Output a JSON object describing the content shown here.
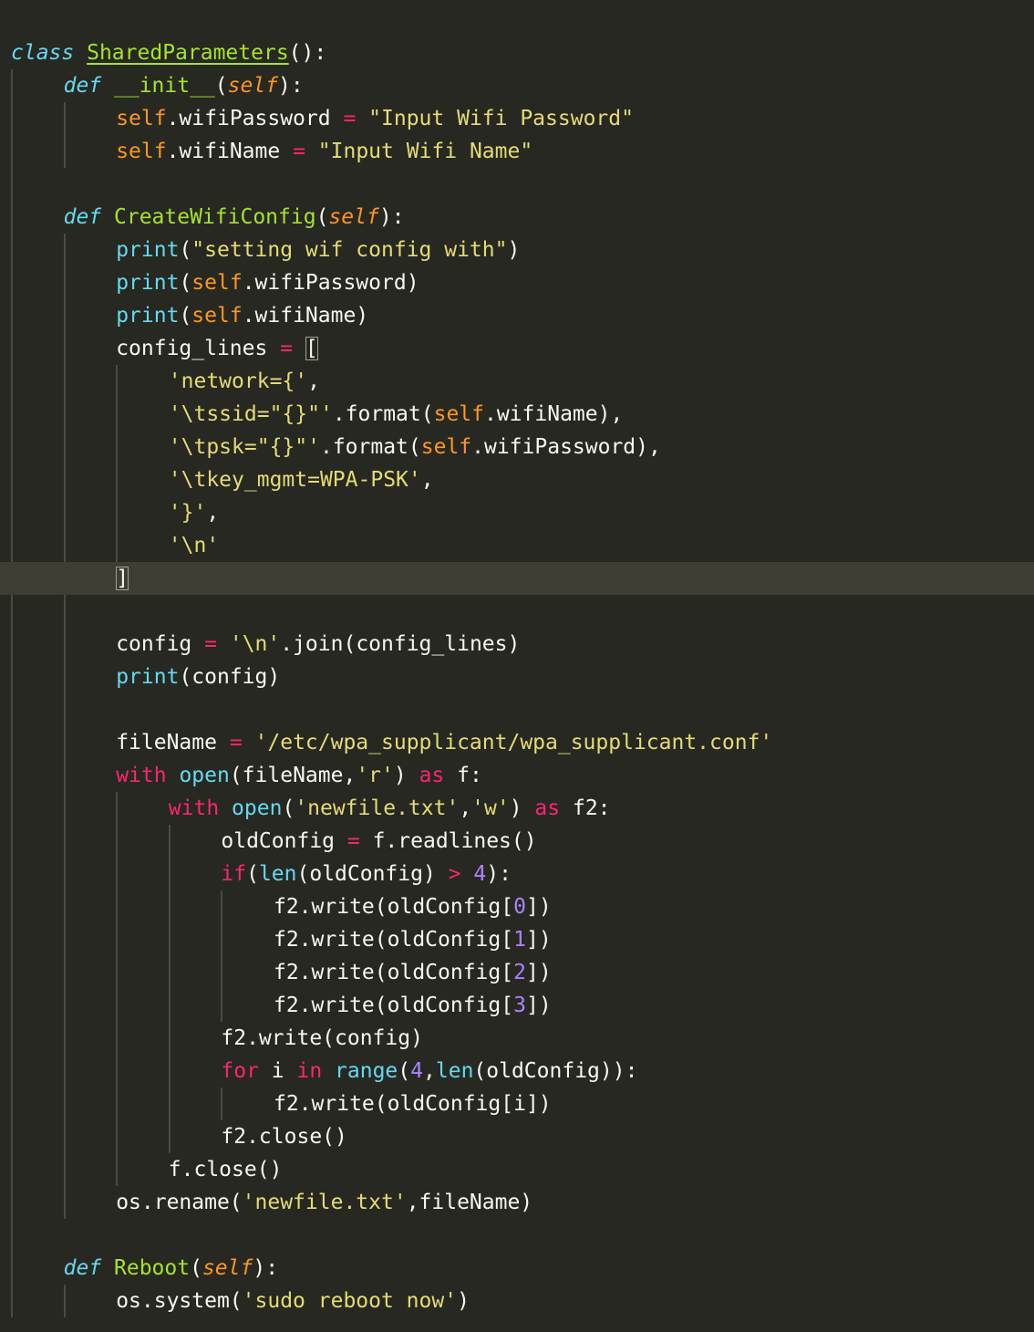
{
  "editor": {
    "language": "python",
    "highlighted_line": 16,
    "colors": {
      "background": "#272822",
      "highlight": "#3e3d32",
      "keyword": "#f92672",
      "storage": "#66d9ef",
      "function": "#a6e22e",
      "string": "#e6db74",
      "number": "#ae81ff",
      "self": "#fd971f",
      "text": "#f8f8f2"
    },
    "lines": [
      {
        "indent": 0,
        "tokens": [
          {
            "t": "class",
            "c": "d"
          },
          {
            "t": " "
          },
          {
            "t": "SharedParameters",
            "c": "cn"
          },
          {
            "t": "():"
          }
        ]
      },
      {
        "indent": 1,
        "tokens": [
          {
            "t": "def",
            "c": "d"
          },
          {
            "t": " "
          },
          {
            "t": "__init__",
            "c": "fn"
          },
          {
            "t": "("
          },
          {
            "t": "self",
            "c": "p"
          },
          {
            "t": "):"
          }
        ]
      },
      {
        "indent": 2,
        "tokens": [
          {
            "t": "self",
            "c": "sf"
          },
          {
            "t": ".wifiPassword "
          },
          {
            "t": "=",
            "c": "k"
          },
          {
            "t": " "
          },
          {
            "t": "\"Input Wifi Password\"",
            "c": "s"
          }
        ]
      },
      {
        "indent": 2,
        "tokens": [
          {
            "t": "self",
            "c": "sf"
          },
          {
            "t": ".wifiName "
          },
          {
            "t": "=",
            "c": "k"
          },
          {
            "t": " "
          },
          {
            "t": "\"Input Wifi Name\"",
            "c": "s"
          }
        ]
      },
      {
        "indent": 0,
        "tokens": []
      },
      {
        "indent": 1,
        "tokens": [
          {
            "t": "def",
            "c": "d"
          },
          {
            "t": " "
          },
          {
            "t": "CreateWifiConfig",
            "c": "fn"
          },
          {
            "t": "("
          },
          {
            "t": "self",
            "c": "p"
          },
          {
            "t": "):"
          }
        ]
      },
      {
        "indent": 2,
        "tokens": [
          {
            "t": "print",
            "c": "b"
          },
          {
            "t": "("
          },
          {
            "t": "\"setting wif config with\"",
            "c": "s"
          },
          {
            "t": ")"
          }
        ]
      },
      {
        "indent": 2,
        "tokens": [
          {
            "t": "print",
            "c": "b"
          },
          {
            "t": "("
          },
          {
            "t": "self",
            "c": "sf"
          },
          {
            "t": ".wifiPassword)"
          }
        ]
      },
      {
        "indent": 2,
        "tokens": [
          {
            "t": "print",
            "c": "b"
          },
          {
            "t": "("
          },
          {
            "t": "self",
            "c": "sf"
          },
          {
            "t": ".wifiName)"
          }
        ]
      },
      {
        "indent": 2,
        "tokens": [
          {
            "t": "config_lines "
          },
          {
            "t": "=",
            "c": "k"
          },
          {
            "t": " "
          },
          {
            "t": "[",
            "c": "bm"
          }
        ]
      },
      {
        "indent": 3,
        "tokens": [
          {
            "t": "'network={'",
            "c": "s"
          },
          {
            "t": ","
          }
        ]
      },
      {
        "indent": 3,
        "tokens": [
          {
            "t": "'\\tssid=\"{}\"'",
            "c": "s"
          },
          {
            "t": ".format("
          },
          {
            "t": "self",
            "c": "sf"
          },
          {
            "t": ".wifiName),"
          }
        ]
      },
      {
        "indent": 3,
        "tokens": [
          {
            "t": "'\\tpsk=\"{}\"'",
            "c": "s"
          },
          {
            "t": ".format("
          },
          {
            "t": "self",
            "c": "sf"
          },
          {
            "t": ".wifiPassword),"
          }
        ]
      },
      {
        "indent": 3,
        "tokens": [
          {
            "t": "'\\tkey_mgmt=WPA-PSK'",
            "c": "s"
          },
          {
            "t": ","
          }
        ]
      },
      {
        "indent": 3,
        "tokens": [
          {
            "t": "'}'",
            "c": "s"
          },
          {
            "t": ","
          }
        ]
      },
      {
        "indent": 3,
        "tokens": [
          {
            "t": "'\\n'",
            "c": "s"
          }
        ]
      },
      {
        "indent": 2,
        "tokens": [
          {
            "t": "]",
            "c": "bm"
          }
        ]
      },
      {
        "indent": 0,
        "tokens": []
      },
      {
        "indent": 2,
        "tokens": [
          {
            "t": "config "
          },
          {
            "t": "=",
            "c": "k"
          },
          {
            "t": " "
          },
          {
            "t": "'\\n'",
            "c": "s"
          },
          {
            "t": ".join(config_lines)"
          }
        ]
      },
      {
        "indent": 2,
        "tokens": [
          {
            "t": "print",
            "c": "b"
          },
          {
            "t": "(config)"
          }
        ]
      },
      {
        "indent": 0,
        "tokens": []
      },
      {
        "indent": 2,
        "tokens": [
          {
            "t": "fileName "
          },
          {
            "t": "=",
            "c": "k"
          },
          {
            "t": " "
          },
          {
            "t": "'/etc/wpa_supplicant/wpa_supplicant.conf'",
            "c": "s"
          }
        ]
      },
      {
        "indent": 2,
        "tokens": [
          {
            "t": "with",
            "c": "k"
          },
          {
            "t": " "
          },
          {
            "t": "open",
            "c": "b"
          },
          {
            "t": "(fileName,"
          },
          {
            "t": "'r'",
            "c": "s"
          },
          {
            "t": ") "
          },
          {
            "t": "as",
            "c": "k"
          },
          {
            "t": " f:"
          }
        ]
      },
      {
        "indent": 3,
        "tokens": [
          {
            "t": "with",
            "c": "k"
          },
          {
            "t": " "
          },
          {
            "t": "open",
            "c": "b"
          },
          {
            "t": "("
          },
          {
            "t": "'newfile.txt'",
            "c": "s"
          },
          {
            "t": ","
          },
          {
            "t": "'w'",
            "c": "s"
          },
          {
            "t": ") "
          },
          {
            "t": "as",
            "c": "k"
          },
          {
            "t": " f2:"
          }
        ]
      },
      {
        "indent": 4,
        "tokens": [
          {
            "t": "oldConfig "
          },
          {
            "t": "=",
            "c": "k"
          },
          {
            "t": " f.readlines()"
          }
        ]
      },
      {
        "indent": 4,
        "tokens": [
          {
            "t": "if",
            "c": "k"
          },
          {
            "t": "("
          },
          {
            "t": "len",
            "c": "b"
          },
          {
            "t": "(oldConfig) "
          },
          {
            "t": ">",
            "c": "k"
          },
          {
            "t": " "
          },
          {
            "t": "4",
            "c": "n"
          },
          {
            "t": "):"
          }
        ]
      },
      {
        "indent": 5,
        "tokens": [
          {
            "t": "f2.write(oldConfig["
          },
          {
            "t": "0",
            "c": "n"
          },
          {
            "t": "])"
          }
        ]
      },
      {
        "indent": 5,
        "tokens": [
          {
            "t": "f2.write(oldConfig["
          },
          {
            "t": "1",
            "c": "n"
          },
          {
            "t": "])"
          }
        ]
      },
      {
        "indent": 5,
        "tokens": [
          {
            "t": "f2.write(oldConfig["
          },
          {
            "t": "2",
            "c": "n"
          },
          {
            "t": "])"
          }
        ]
      },
      {
        "indent": 5,
        "tokens": [
          {
            "t": "f2.write(oldConfig["
          },
          {
            "t": "3",
            "c": "n"
          },
          {
            "t": "])"
          }
        ]
      },
      {
        "indent": 4,
        "tokens": [
          {
            "t": "f2.write(config)"
          }
        ]
      },
      {
        "indent": 4,
        "tokens": [
          {
            "t": "for",
            "c": "k"
          },
          {
            "t": " i "
          },
          {
            "t": "in",
            "c": "k"
          },
          {
            "t": " "
          },
          {
            "t": "range",
            "c": "b"
          },
          {
            "t": "("
          },
          {
            "t": "4",
            "c": "n"
          },
          {
            "t": ","
          },
          {
            "t": "len",
            "c": "b"
          },
          {
            "t": "(oldConfig)):"
          }
        ]
      },
      {
        "indent": 5,
        "tokens": [
          {
            "t": "f2.write(oldConfig[i])"
          }
        ]
      },
      {
        "indent": 4,
        "tokens": [
          {
            "t": "f2.close()"
          }
        ]
      },
      {
        "indent": 3,
        "tokens": [
          {
            "t": "f.close()"
          }
        ]
      },
      {
        "indent": 2,
        "tokens": [
          {
            "t": "os.rename("
          },
          {
            "t": "'newfile.txt'",
            "c": "s"
          },
          {
            "t": ",fileName)"
          }
        ]
      },
      {
        "indent": 0,
        "tokens": []
      },
      {
        "indent": 1,
        "tokens": [
          {
            "t": "def",
            "c": "d"
          },
          {
            "t": " "
          },
          {
            "t": "Reboot",
            "c": "fn"
          },
          {
            "t": "("
          },
          {
            "t": "self",
            "c": "p"
          },
          {
            "t": "):"
          }
        ]
      },
      {
        "indent": 2,
        "tokens": [
          {
            "t": "os.system("
          },
          {
            "t": "'sudo reboot now'",
            "c": "s"
          },
          {
            "t": ")"
          }
        ]
      }
    ]
  }
}
